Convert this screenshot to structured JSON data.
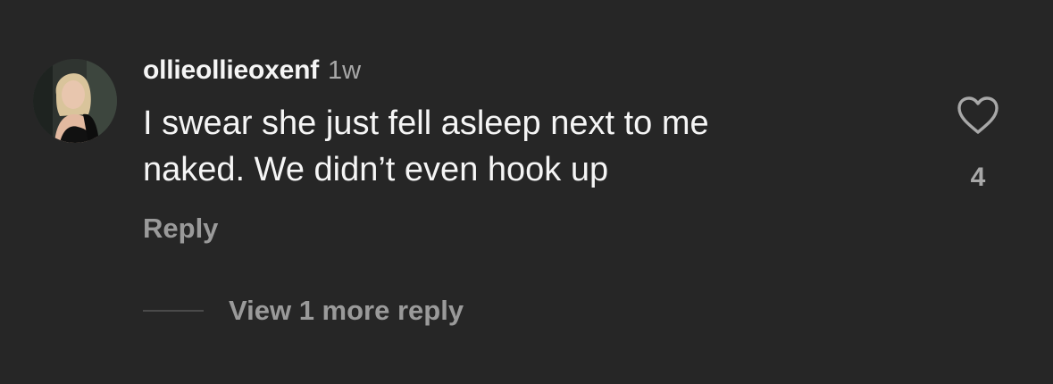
{
  "comment": {
    "username": "ollieollieoxenf",
    "timestamp": "1w",
    "text_line1": "I swear she just fell asleep next to me",
    "text_line2": "naked. We didn’t even hook up",
    "reply_label": "Reply",
    "view_more_label": "View 1 more reply",
    "like_count": "4",
    "like_icon": "heart-outline-icon",
    "avatar_icon": "user-avatar-photo"
  },
  "colors": {
    "background": "#262626",
    "primary_text": "#f5f5f5",
    "secondary_text": "#a8a8a8"
  }
}
